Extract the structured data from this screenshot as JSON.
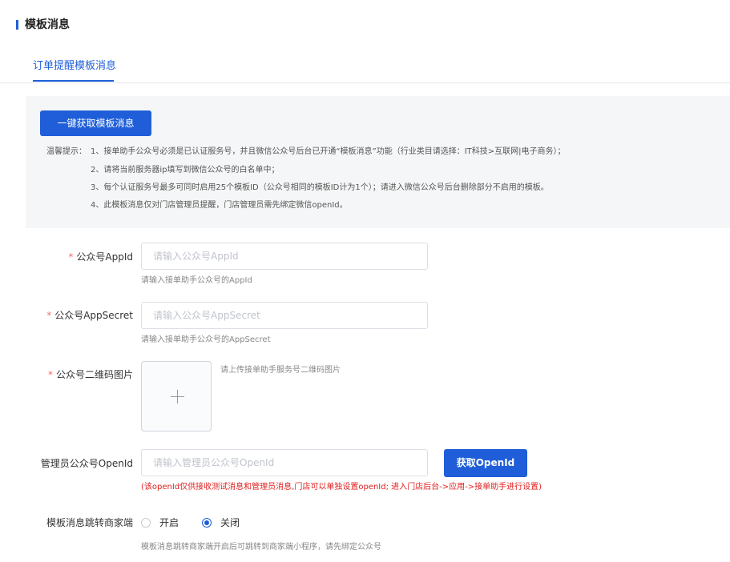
{
  "section": {
    "title": "模板消息"
  },
  "tabs": [
    {
      "label": "订单提醒模板消息",
      "active": true
    }
  ],
  "notice": {
    "fetch_button": "一键获取模板消息",
    "prefix": "温馨提示：",
    "tips": [
      "1、接单助手公众号必须是已认证服务号，并且微信公众号后台已开通“模板消息”功能（行业类目请选择：IT科技>互联网|电子商务）；",
      "2、请将当前服务器ip填写到微信公众号的白名单中；",
      "3、每个认证服务号最多可同时启用25个模板ID（公众号相同的模板ID计为1个）；请进入微信公众号后台删除部分不启用的模板。",
      "4、此模板消息仅对门店管理员提醒，门店管理员需先绑定微信openId。"
    ]
  },
  "form": {
    "required_mark": "*",
    "appid": {
      "label": "公众号AppId",
      "placeholder": "请输入公众号AppId",
      "value": "",
      "hint": "请输入接单助手公众号的AppId"
    },
    "appsecret": {
      "label": "公众号AppSecret",
      "placeholder": "请输入公众号AppSecret",
      "value": "",
      "hint": "请输入接单助手公众号的AppSecret"
    },
    "qrcode": {
      "label": "公众号二维码图片",
      "hint": "请上传接单助手服务号二维码图片"
    },
    "openid": {
      "label": "管理员公众号OpenId",
      "placeholder": "请输入管理员公众号OpenId",
      "value": "",
      "button": "获取OpenId",
      "warning": "(该openId仅供接收测试消息和管理员消息,门店可以单独设置openId; 进入门店后台->应用->接单助手进行设置)"
    },
    "redirect": {
      "label": "模板消息跳转商家端",
      "options": [
        {
          "label": "开启",
          "selected": false
        },
        {
          "label": "关闭",
          "selected": true
        }
      ],
      "hint": "模板消息跳转商家端开启后可跳转到商家端小程序，请先绑定公众号"
    }
  },
  "colors": {
    "primary": "#1f5ed8",
    "required": "#f56c6c",
    "warning": "#e02020",
    "notice_bg": "#f5f6f7"
  }
}
